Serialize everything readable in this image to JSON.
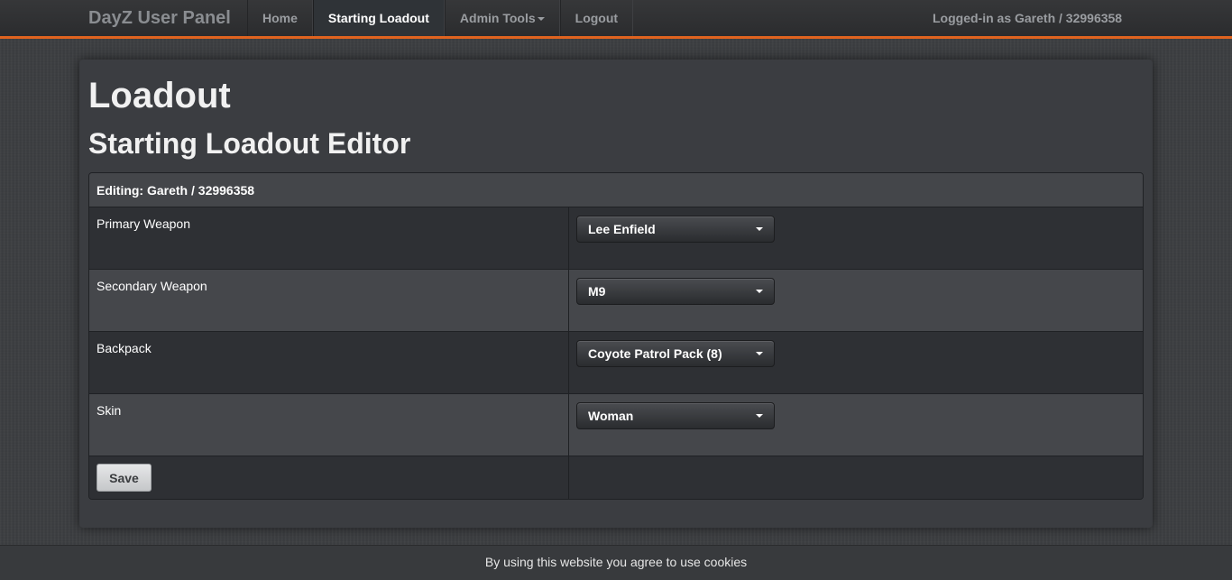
{
  "navbar": {
    "brand": "DayZ User Panel",
    "items": [
      {
        "label": "Home"
      },
      {
        "label": "Starting Loadout",
        "active": true
      },
      {
        "label": "Admin Tools"
      },
      {
        "label": "Logout"
      }
    ],
    "user_info": "Logged-in as Gareth / 32996358",
    "accent_color": "#e0631f"
  },
  "page": {
    "title": "Loadout",
    "subtitle": "Starting Loadout Editor"
  },
  "table": {
    "header": "Editing: Gareth / 32996358",
    "rows": [
      {
        "label": "Primary Weapon",
        "value": "Lee Enfield"
      },
      {
        "label": "Secondary Weapon",
        "value": "M9"
      },
      {
        "label": "Backpack",
        "value": "Coyote Patrol Pack (8)"
      },
      {
        "label": "Skin",
        "value": "Woman"
      }
    ],
    "save_label": "Save"
  },
  "cookie_notice": "By using this website you agree to use cookies"
}
